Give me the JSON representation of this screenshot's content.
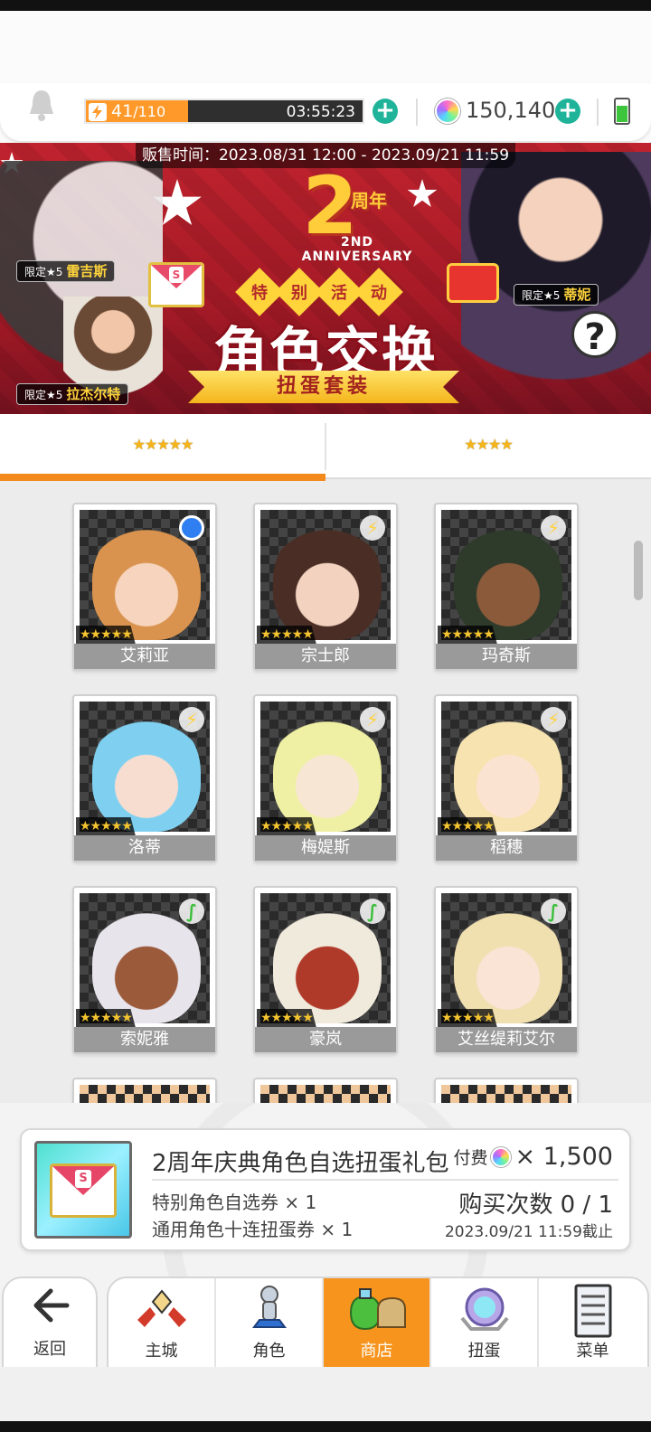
{
  "topbar": {
    "stamina_current": "41",
    "stamina_max": "110",
    "stamina_fraction": 0.37,
    "stamina_timer": "03:55:23",
    "gem_count": "150,140"
  },
  "banner": {
    "sale_time": "贩售时间：2023.08/31 12:00 - 2023.09/21 11:59",
    "anniv_number": "2",
    "anniv_zhounian": "周年",
    "anniv_sub": "2ND ANNIVERSARY",
    "event_tags": [
      "特",
      "别",
      "活",
      "动"
    ],
    "main_title": "角色交换",
    "ribbon": "扭蛋套装",
    "limit_prefix": "限定★5",
    "limit_names": [
      "雷吉斯",
      "拉杰尔特",
      "蒂妮"
    ],
    "help": "?"
  },
  "tabs": [
    {
      "label": "★★★★★",
      "active": true
    },
    {
      "label": "★★★★",
      "active": false
    }
  ],
  "characters": [
    {
      "name": "艾莉亚",
      "element": "water",
      "stars": "★★★★★",
      "skin": "#f6d4be",
      "hair": "#d9934e"
    },
    {
      "name": "宗士郎",
      "element": "light",
      "stars": "★★★★★",
      "skin": "#f3d2bf",
      "hair": "#4a2e25"
    },
    {
      "name": "玛奇斯",
      "element": "light",
      "stars": "★★★★★",
      "skin": "#8a5a3a",
      "hair": "#2e3a2a"
    },
    {
      "name": "洛蒂",
      "element": "light",
      "stars": "★★★★★",
      "skin": "#f7ddd0",
      "hair": "#7fd0f0"
    },
    {
      "name": "梅媞斯",
      "element": "light",
      "stars": "★★★★★",
      "skin": "#f8e6d4",
      "hair": "#eff0a4"
    },
    {
      "name": "稻穗",
      "element": "light",
      "stars": "★★★★★",
      "skin": "#fbe3d2",
      "hair": "#f6e3b0"
    },
    {
      "name": "索妮雅",
      "element": "wind",
      "stars": "★★★★★",
      "skin": "#9b5a3a",
      "hair": "#e8e4ec"
    },
    {
      "name": "豪岚",
      "element": "wind",
      "stars": "★★★★★",
      "skin": "#b03a2a",
      "hair": "#f0eadc"
    },
    {
      "name": "艾丝缇莉艾尔",
      "element": "wind",
      "stars": "★★★★★",
      "skin": "#f9e4d6",
      "hair": "#f0dfaf"
    }
  ],
  "purchase": {
    "title": "2周年庆典角色自选扭蛋礼包",
    "price_label": "付费",
    "price_amount": "× 1,500",
    "items": [
      "特别角色自选券 × 1",
      "通用角色十连扭蛋券 × 1"
    ],
    "purchase_count": "购买次数 0 / 1",
    "deadline": "2023.09/21 11:59截止"
  },
  "nav": {
    "back": "返回",
    "items": [
      {
        "label": "主城",
        "icon": "castle-icon",
        "active": false
      },
      {
        "label": "角色",
        "icon": "character-icon",
        "active": false
      },
      {
        "label": "商店",
        "icon": "shop-icon",
        "active": true
      },
      {
        "label": "扭蛋",
        "icon": "gacha-icon",
        "active": false
      },
      {
        "label": "菜单",
        "icon": "menu-icon",
        "active": false
      }
    ]
  },
  "colors": {
    "accent": "#f7941d",
    "stamina": "#ff9a2a",
    "plus": "#1fb49a",
    "banner": "#c0232e"
  }
}
